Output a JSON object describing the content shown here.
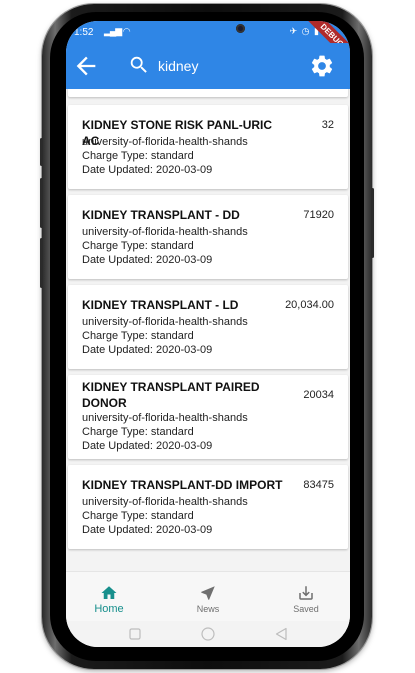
{
  "status_bar": {
    "time": "1:52",
    "debug_label": "DEBUG"
  },
  "app_bar": {
    "search_value": "kidney",
    "icons": [
      "back-arrow-icon",
      "search-icon",
      "gear-icon"
    ]
  },
  "results": [
    {
      "title": "KIDNEY STONE RISK PANL-URIC AC",
      "price": "32",
      "provider": "university-of-florida-health-shands",
      "charge_type": "Charge Type: standard",
      "date_updated": "Date Updated: 2020-03-09"
    },
    {
      "title": "KIDNEY TRANSPLANT - DD",
      "price": "71920",
      "provider": "university-of-florida-health-shands",
      "charge_type": "Charge Type: standard",
      "date_updated": "Date Updated: 2020-03-09"
    },
    {
      "title": "KIDNEY TRANSPLANT - LD",
      "price": "20,034.00",
      "provider": "university-of-florida-health-shands",
      "charge_type": "Charge Type: standard",
      "date_updated": "Date Updated: 2020-03-09"
    },
    {
      "title": "KIDNEY TRANSPLANT PAIRED DONOR",
      "price": "20034",
      "provider": "university-of-florida-health-shands",
      "charge_type": "Charge Type: standard",
      "date_updated": "Date Updated: 2020-03-09"
    },
    {
      "title": "KIDNEY TRANSPLANT-DD IMPORT",
      "price": "83475",
      "provider": "university-of-florida-health-shands",
      "charge_type": "Charge Type: standard",
      "date_updated": "Date Updated: 2020-03-09"
    }
  ],
  "bottom_nav": [
    {
      "label": "Home",
      "icon": "home-icon",
      "active": true
    },
    {
      "label": "News",
      "icon": "navigation-arrow-icon",
      "active": false
    },
    {
      "label": "Saved",
      "icon": "download-icon",
      "active": false
    }
  ],
  "colors": {
    "app_bar": "#2f86e6",
    "active_nav": "#178f8c",
    "debug_ribbon": "#b02a2a"
  }
}
